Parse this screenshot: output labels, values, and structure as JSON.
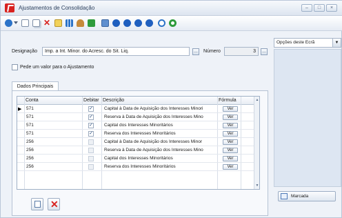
{
  "window": {
    "title": "Ajustamentos de Consolidação",
    "controls": [
      "–",
      "□",
      "×"
    ]
  },
  "toolbar": {
    "icons": [
      "refresh-icon",
      "dropdown-icon",
      "new-icon",
      "copy-icon",
      "delete-icon",
      "edit-icon",
      "grid-icon",
      "person-icon",
      "export-icon",
      "print-icon",
      "nav-first-icon",
      "nav-prev-icon",
      "nav-next-icon",
      "nav-last-icon",
      "help-icon",
      "search-icon"
    ]
  },
  "form": {
    "designacao_label": "Designação",
    "designacao_value": "Imp. a Int. Minor. do Acresc. do Sit. Liq.",
    "numero_label": "Número",
    "numero_value": "3",
    "pede_valor_label": "Pede um valor para o Ajustamento",
    "pede_valor_checked": false
  },
  "tabs": [
    {
      "label": "Dados Principais"
    }
  ],
  "grid": {
    "columns": {
      "conta": "Conta",
      "debitar": "Debitar",
      "descricao": "Descrição",
      "formula": "Fórmula"
    },
    "ver_label": "Ver",
    "rows": [
      {
        "conta": "571",
        "debitar": true,
        "descricao": "Capital à Data de Aquisição dos Interesses Minori",
        "active": true
      },
      {
        "conta": "571",
        "debitar": true,
        "descricao": "Reserva à Data de Aquisição dos Interesses Mino",
        "active": true
      },
      {
        "conta": "571",
        "debitar": true,
        "descricao": "Capital dos Interesses Minoritários",
        "active": true
      },
      {
        "conta": "571",
        "debitar": true,
        "descricao": "Reserva dos Interesses Minoritários",
        "active": true
      },
      {
        "conta": "256",
        "debitar": false,
        "descricao": "Capital à Data de Aquisição dos Interesses Minor",
        "active": false
      },
      {
        "conta": "256",
        "debitar": false,
        "descricao": "Reserva à Data de Aquisição dos Interesses Mino",
        "active": false
      },
      {
        "conta": "256",
        "debitar": false,
        "descricao": "Capital dos Interesses Minoritários",
        "active": false
      },
      {
        "conta": "256",
        "debitar": false,
        "descricao": "Reserva dos Interesses Minoritários",
        "active": false
      }
    ]
  },
  "side": {
    "opcoes_label": "Opções deste Ecrã",
    "marcada_label": "Marcada"
  },
  "colors": {
    "accent": "#d8221f",
    "nav_blue": "#1f5fbf",
    "green": "#2e9b3c"
  }
}
